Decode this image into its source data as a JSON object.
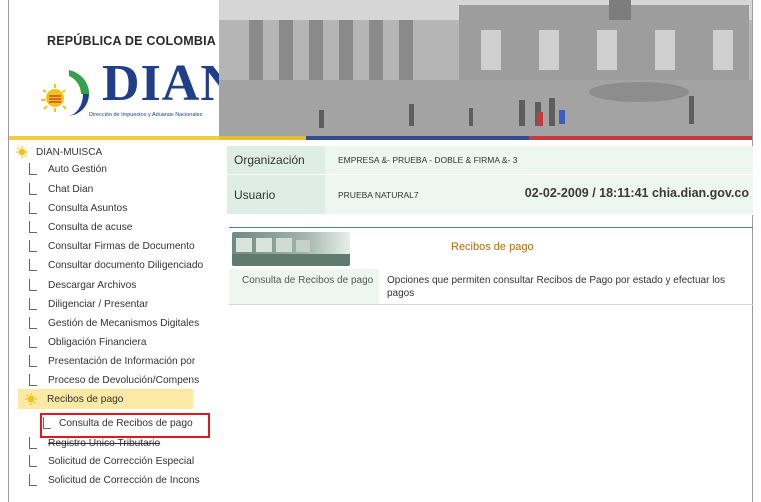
{
  "header": {
    "country": "REPÚBLICA DE COLOMBIA",
    "brand": "DIAN",
    "brand_subtitle": "Dirección de Impuestos y Aduanas Nacionales"
  },
  "sidebar": {
    "root_label": "DIAN-MUISCA",
    "items": [
      {
        "label": "Auto Gestión"
      },
      {
        "label": "Chat Dian"
      },
      {
        "label": "Consulta Asuntos"
      },
      {
        "label": "Consulta de acuse"
      },
      {
        "label": "Consultar Firmas de Documento"
      },
      {
        "label": "Consultar documento Diligenciado"
      },
      {
        "label": "Descargar Archivos"
      },
      {
        "label": "Diligenciar / Presentar"
      },
      {
        "label": "Gestión de Mecanismos Digitales"
      },
      {
        "label": "Obligación Financiera"
      },
      {
        "label": "Presentación de Información por"
      },
      {
        "label": "Proceso de Devolución/Compens"
      }
    ],
    "active_label": "Recibos de pago",
    "active_sub_label": "Consulta de Recibos de pago",
    "after_items": [
      {
        "label": "Registro Único Tributario"
      },
      {
        "label": "Solicitud de Corrección Especial"
      },
      {
        "label": "Solicitud de Corrección de Incons"
      }
    ]
  },
  "info": {
    "org_label": "Organización",
    "org_value": "EMPRESA &- PRUEBA - DOBLE & FIRMA &- 3",
    "user_label": "Usuario",
    "user_value": "PRUEBA NATURAL7",
    "datetime": "02-02-2009 / 18:11:41 chia.dian.gov.co"
  },
  "section": {
    "title": "Recibos de pago",
    "link": "Consulta de Recibos de pago",
    "description": "Opciones que permiten consultar Recibos de Pago por estado y efectuar los pagos"
  },
  "colors": {
    "brand_blue": "#1f3f8a",
    "label_bg": "#dfeee5",
    "value_bg": "#eef6f1",
    "active_bg": "#fbe9a5",
    "section_title": "#b36b0b",
    "highlight": "#e0191f"
  }
}
